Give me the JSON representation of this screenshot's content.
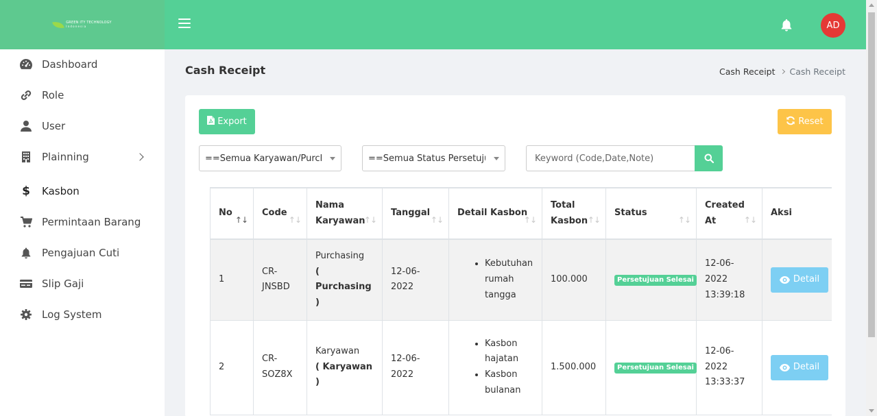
{
  "brand": {
    "line1": "GREEN ITY TECHNOLOGY",
    "line2": "Indonesia"
  },
  "header": {
    "avatar_initials": "AD",
    "icons": [
      "menu-icon",
      "bell-icon"
    ]
  },
  "sidebar": {
    "items": [
      {
        "label": "Dashboard",
        "icon": "dashboard-icon"
      },
      {
        "label": "Role",
        "icon": "link-icon"
      },
      {
        "label": "User",
        "icon": "user-icon"
      },
      {
        "label": "Plainning",
        "icon": "building-icon",
        "has_submenu": true
      },
      {
        "label": "Kasbon",
        "icon": "dollar-icon",
        "active": true
      },
      {
        "label": "Permintaan Barang",
        "icon": "cart-icon"
      },
      {
        "label": "Pengajuan Cuti",
        "icon": "bell-icon"
      },
      {
        "label": "Slip Gaji",
        "icon": "card-icon"
      },
      {
        "label": "Log System",
        "icon": "gear-icon"
      }
    ]
  },
  "page": {
    "title": "Cash Receipt",
    "breadcrumb": [
      "Cash Receipt",
      "Cash Receipt"
    ]
  },
  "toolbar": {
    "export_label": "Export",
    "reset_label": "Reset",
    "filter_employee": "==Semua Karyawan/Purch…",
    "filter_status": "==Semua Status Persetuju…",
    "search_placeholder": "Keyword (Code,Date,Note)"
  },
  "table": {
    "headers": [
      {
        "line1": "No",
        "line2": "",
        "sort": "↑↓",
        "sort_active": true
      },
      {
        "line1": "Code",
        "line2": "",
        "sort": "↑↓"
      },
      {
        "line1": "Nama",
        "line2": "Karyawan",
        "sort": "↑↓"
      },
      {
        "line1": "Tanggal",
        "line2": "",
        "sort": "↑↓"
      },
      {
        "line1": "Detail Kasbon",
        "line2": "",
        "sort": "↑↓"
      },
      {
        "line1": "Total",
        "line2": "Kasbon",
        "sort": "↑↓"
      },
      {
        "line1": "Status",
        "line2": "",
        "sort": "↑↓"
      },
      {
        "line1": "Created",
        "line2": "At",
        "sort": "↑↓"
      },
      {
        "line1": "Aksi",
        "line2": ""
      }
    ],
    "rows": [
      {
        "no": "1",
        "code": "CR-JNSBD",
        "name": "Purchasing",
        "name_role": "( Purchasing )",
        "tanggal": "12-06-2022",
        "details": [
          "Kebutuhan rumah tangga"
        ],
        "total": "100.000",
        "status": "Persetujuan Selesai",
        "created_date": "12-06-2022",
        "created_time": "13:39:18",
        "action": "Detail"
      },
      {
        "no": "2",
        "code": "CR-SOZ8X",
        "name": "Karyawan",
        "name_role": "( Karyawan )",
        "tanggal": "12-06-2022",
        "details": [
          "Kasbon hajatan",
          "Kasbon bulanan"
        ],
        "total": "1.500.000",
        "status": "Persetujuan Selesai",
        "created_date": "12-06-2022",
        "created_time": "13:33:37",
        "action": "Detail"
      }
    ]
  },
  "colors": {
    "primary": "#54d096",
    "warning": "#fdc448",
    "info": "#7dcff3",
    "avatar": "#e53935"
  }
}
